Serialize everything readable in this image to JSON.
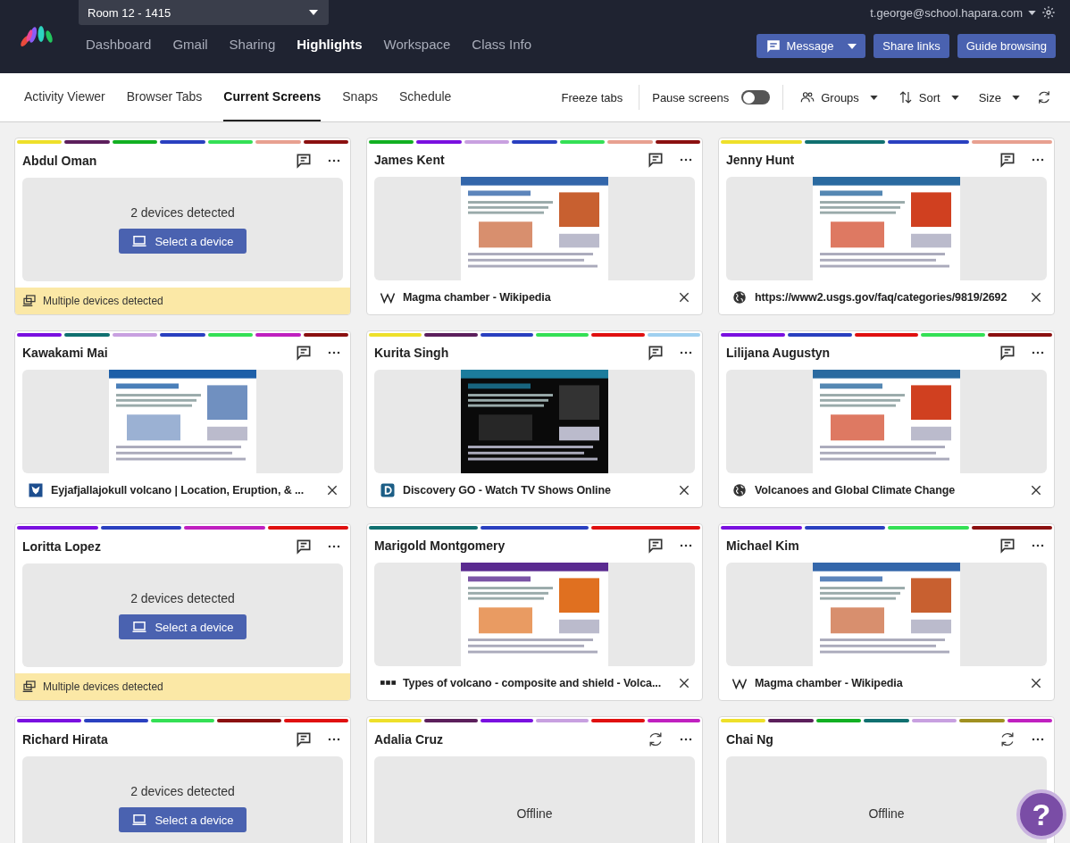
{
  "topbar": {
    "room": "Room 12 - 1415",
    "nav": [
      {
        "label": "Dashboard",
        "selected": false
      },
      {
        "label": "Gmail",
        "selected": false
      },
      {
        "label": "Sharing",
        "selected": false
      },
      {
        "label": "Highlights",
        "selected": true
      },
      {
        "label": "Workspace",
        "selected": false
      },
      {
        "label": "Class Info",
        "selected": false
      }
    ],
    "user": "t.george@school.hapara.com",
    "buttons": [
      "Message",
      "Share links",
      "Guide browsing"
    ]
  },
  "subnav": {
    "tabs": [
      {
        "label": "Activity Viewer",
        "selected": false
      },
      {
        "label": "Browser Tabs",
        "selected": false
      },
      {
        "label": "Current Screens",
        "selected": true
      },
      {
        "label": "Snaps",
        "selected": false
      },
      {
        "label": "Schedule",
        "selected": false
      }
    ],
    "freeze": "Freeze tabs",
    "pause": {
      "label": "Pause screens",
      "on": false
    },
    "menus": [
      {
        "kind": "groups",
        "label": "Groups"
      },
      {
        "kind": "sort",
        "label": "Sort"
      },
      {
        "kind": "size",
        "label": "Size"
      }
    ]
  },
  "cards": [
    {
      "name": "Abdul Oman",
      "kind": "multi",
      "groups": [
        {
          "color": "#eee02a"
        },
        {
          "color": "#5c1f5c"
        },
        {
          "color": "#12b022"
        },
        {
          "color": "#2a40c0"
        },
        {
          "color": "#34e055"
        },
        {
          "color": "#e8a090"
        },
        {
          "color": "#8b1010"
        }
      ],
      "devices": "2 devices detected",
      "select": "Select a device",
      "warning": "Multiple devices detected"
    },
    {
      "name": "James Kent",
      "kind": "screen",
      "groups": [
        {
          "color": "#12b022"
        },
        {
          "color": "#7a10e0"
        },
        {
          "color": "#c8a0e0"
        },
        {
          "color": "#2a40c0"
        },
        {
          "color": "#34e055"
        },
        {
          "color": "#e8a090"
        },
        {
          "color": "#8b1010"
        }
      ],
      "tab": {
        "kind": "wiki",
        "title": "Magma chamber - Wikipedia"
      }
    },
    {
      "name": "Jenny Hunt",
      "kind": "screen",
      "groups": [
        {
          "color": "#eee02a"
        },
        {
          "color": "#107070"
        },
        {
          "color": "#2a40c0"
        },
        {
          "color": "#e8a090"
        }
      ],
      "tab": {
        "kind": "globe",
        "title": "https://www2.usgs.gov/faq/categories/9819/2692"
      }
    },
    {
      "name": "Kawakami Mai",
      "kind": "screen",
      "groups": [
        {
          "color": "#7a10e0"
        },
        {
          "color": "#107070"
        },
        {
          "color": "#c8a0e0"
        },
        {
          "color": "#2a40c0"
        },
        {
          "color": "#34e055"
        },
        {
          "color": "#c020c0"
        },
        {
          "color": "#8b1010"
        }
      ],
      "tab": {
        "kind": "crest",
        "title": "Eyjafjallajokull volcano | Location, Eruption, & ..."
      }
    },
    {
      "name": "Kurita Singh",
      "kind": "screen",
      "groups": [
        {
          "color": "#eee02a"
        },
        {
          "color": "#5c1f5c"
        },
        {
          "color": "#2a40c0"
        },
        {
          "color": "#34e055"
        },
        {
          "color": "#e01010"
        },
        {
          "color": "#a0d0f0"
        }
      ],
      "tab": {
        "kind": "disc",
        "title": "Discovery GO - Watch TV Shows Online"
      }
    },
    {
      "name": "Lilijana Augustyn",
      "kind": "screen",
      "groups": [
        {
          "color": "#7a10e0"
        },
        {
          "color": "#2a40c0"
        },
        {
          "color": "#e01010"
        },
        {
          "color": "#34e055"
        },
        {
          "color": "#8b1010"
        }
      ],
      "tab": {
        "kind": "globe",
        "title": "Volcanoes and Global Climate Change"
      }
    },
    {
      "name": "Loritta Lopez",
      "kind": "multi",
      "groups": [
        {
          "color": "#7a10e0"
        },
        {
          "color": "#2a40c0"
        },
        {
          "color": "#c020c0"
        },
        {
          "color": "#e01010"
        }
      ],
      "devices": "2 devices detected",
      "select": "Select a device",
      "warning": "Multiple devices detected"
    },
    {
      "name": "Marigold Montgomery",
      "kind": "screen",
      "groups": [
        {
          "color": "#107070"
        },
        {
          "color": "#2a40c0"
        },
        {
          "color": "#e01010"
        }
      ],
      "tab": {
        "kind": "blocks",
        "title": "Types of volcano - composite and shield - Volca..."
      }
    },
    {
      "name": "Michael Kim",
      "kind": "screen",
      "groups": [
        {
          "color": "#7a10e0"
        },
        {
          "color": "#2a40c0"
        },
        {
          "color": "#34e055"
        },
        {
          "color": "#8b1010"
        }
      ],
      "tab": {
        "kind": "wiki",
        "title": "Magma chamber - Wikipedia"
      }
    },
    {
      "name": "Richard Hirata",
      "kind": "multi",
      "groups": [
        {
          "color": "#7a10e0"
        },
        {
          "color": "#2a40c0"
        },
        {
          "color": "#34e055"
        },
        {
          "color": "#8b1010"
        },
        {
          "color": "#e01010"
        }
      ],
      "devices": "2 devices detected",
      "select": "Select a device"
    },
    {
      "name": "Adalia Cruz",
      "kind": "offline",
      "groups": [
        {
          "color": "#eee02a"
        },
        {
          "color": "#5c1f5c"
        },
        {
          "color": "#7a10e0"
        },
        {
          "color": "#c8a0e0"
        },
        {
          "color": "#e01010"
        },
        {
          "color": "#c020c0"
        }
      ],
      "status": "Offline"
    },
    {
      "name": "Chai Ng",
      "kind": "offline",
      "groups": [
        {
          "color": "#eee02a"
        },
        {
          "color": "#5c1f5c"
        },
        {
          "color": "#12b022"
        },
        {
          "color": "#107070"
        },
        {
          "color": "#c8a0e0"
        },
        {
          "color": "#a09020"
        },
        {
          "color": "#c020c0"
        }
      ],
      "status": "Offline"
    }
  ],
  "help": "?"
}
